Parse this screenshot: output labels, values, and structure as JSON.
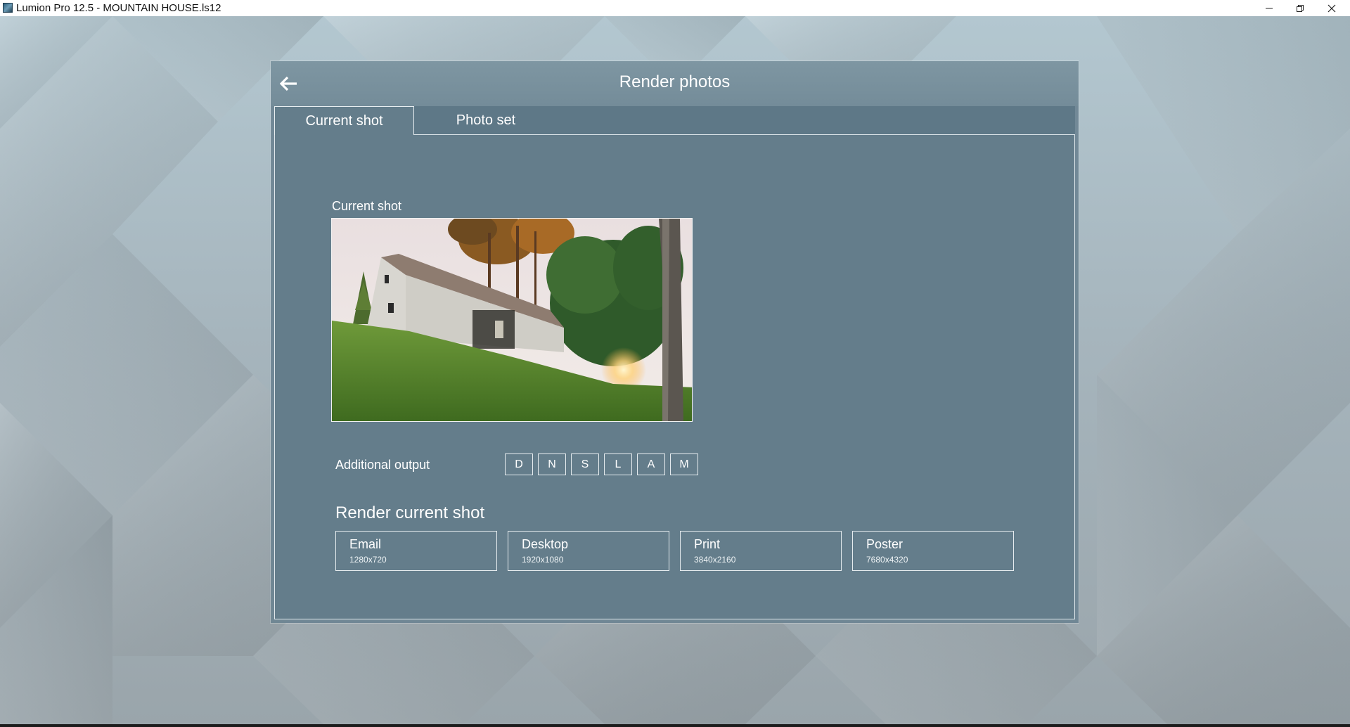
{
  "window": {
    "title": "Lumion Pro 12.5 - MOUNTAIN HOUSE.ls12",
    "icons": [
      "lumion-app-icon",
      "minimize-icon",
      "restore-icon",
      "close-icon"
    ]
  },
  "dialog": {
    "title": "Render photos",
    "back_icon": "arrow-left-icon",
    "tabs": [
      {
        "label": "Current shot",
        "active": true
      },
      {
        "label": "Photo set",
        "active": false
      }
    ]
  },
  "current_shot": {
    "label": "Current shot",
    "preview": "thumbnail of white barn-style house on grassy hillside with trees"
  },
  "additional_output": {
    "label": "Additional output",
    "buttons": [
      "D",
      "N",
      "S",
      "L",
      "A",
      "M"
    ]
  },
  "render_current_shot": {
    "heading": "Render current shot",
    "presets": [
      {
        "name": "Email",
        "size": "1280x720"
      },
      {
        "name": "Desktop",
        "size": "1920x1080"
      },
      {
        "name": "Print",
        "size": "3840x2160"
      },
      {
        "name": "Poster",
        "size": "7680x4320"
      }
    ]
  },
  "colors": {
    "dialog_bg": "#647d8b",
    "header_bg": "#7e96a2",
    "tabbar_bg": "#5e7887",
    "text": "#ffffff"
  }
}
